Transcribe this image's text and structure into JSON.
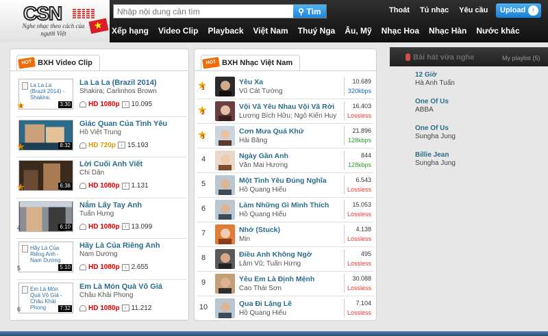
{
  "header": {
    "logo_text": "CSN",
    "slogan": "Nghe nhạc theo cách của người Việt",
    "search_placeholder": "Nhập nội dung cần tìm",
    "search_button": "Tìm",
    "links": [
      "Thoát",
      "Tủ nhạc",
      "Yêu cầu"
    ],
    "upload_label": "Upload"
  },
  "nav": [
    "Xếp hạng",
    "Video Clip",
    "Playback",
    "Việt Nam",
    "Thuý Nga",
    "Âu, Mỹ",
    "Nhạc Hoa",
    "Nhạc Hàn",
    "Nước khác"
  ],
  "video_panel": {
    "title": "BXH Video Clip",
    "hot_badge": "HOT",
    "items": [
      {
        "rank": "1",
        "title": "La La La (Brazil 2014)",
        "artist": "Shakira; Carlinhos Brown",
        "thumb_text": "La La La (Brazil 2014) - Shakira;",
        "duration": "3:30",
        "quality": "HD 1080p",
        "views": "10.095"
      },
      {
        "rank": "2",
        "title": "Giác Quan Của Tình Yêu",
        "artist": "Hồ Việt Trung",
        "thumb_text": "",
        "duration": "8:32",
        "quality": "HD 720p",
        "views": "15.193"
      },
      {
        "rank": "3",
        "title": "Lời Cuối Anh Viết",
        "artist": "Chi Dân",
        "thumb_text": "",
        "duration": "6:38",
        "quality": "HD 1080p",
        "views": "1.131"
      },
      {
        "rank": "4",
        "title": "Nắm Lấy Tay Anh",
        "artist": "Tuấn Hưng",
        "thumb_text": "",
        "duration": "6:10",
        "quality": "HD 1080p",
        "views": "13.099"
      },
      {
        "rank": "5",
        "title": "Hãy Là Của Riêng Anh",
        "artist": "Nam Dương",
        "thumb_text": "Hãy Là Của Riêng Anh - Nam Dương",
        "duration": "5:10",
        "quality": "HD 1080p",
        "views": "2.655"
      },
      {
        "rank": "6",
        "title": "Em Là Món Quà Vô Giá",
        "artist": "Châu Khải Phong",
        "thumb_text": "Em Là Món Quà Vô Giá - Châu Khải Phong",
        "duration": "7:32",
        "quality": "HD 1080p",
        "views": "11.212"
      }
    ]
  },
  "song_panel": {
    "title": "BXH Nhạc Việt Nam",
    "hot_badge": "HOT",
    "items": [
      {
        "rank": "1",
        "title": "Yêu Xa",
        "artist": "Vũ Cát Tường",
        "plays": "10.689",
        "quality": "320kbps"
      },
      {
        "rank": "2",
        "title": "Vội Vã Yêu Nhau Vội Vã Rời",
        "artist": "Lương Bích Hữu; Ngô Kiến Huy",
        "plays": "16.403",
        "quality": "Lossless"
      },
      {
        "rank": "3",
        "title": "Cơn Mưa Quá Khứ",
        "artist": "Hải Băng",
        "plays": "21.896",
        "quality": "128kbps"
      },
      {
        "rank": "4",
        "title": "Ngày Gần Anh",
        "artist": "Văn Mai Hương",
        "plays": "844",
        "quality": "128kbps"
      },
      {
        "rank": "5",
        "title": "Một Tình Yêu Đúng Nghĩa",
        "artist": "Hồ Quang Hiếu",
        "plays": "6.543",
        "quality": "Lossless"
      },
      {
        "rank": "6",
        "title": "Làm Những Gì Mình Thích",
        "artist": "Hồ Quang Hiếu",
        "plays": "15.053",
        "quality": "Lossless"
      },
      {
        "rank": "7",
        "title": "Nhớ (Stuck)",
        "artist": "Min",
        "plays": "4.138",
        "quality": "Lossless"
      },
      {
        "rank": "8",
        "title": "Điều Anh Không Ngờ",
        "artist": "Lâm Vũ; Tuấn Hưng",
        "plays": "495",
        "quality": "Lossless"
      },
      {
        "rank": "9",
        "title": "Yêu Em Là Định Mệnh",
        "artist": "Cao Thái Sơn",
        "plays": "30.088",
        "quality": "Lossless"
      },
      {
        "rank": "10",
        "title": "Qua Đi Lặng Lẽ",
        "artist": "Hồ Quang Hiếu",
        "plays": "7.104",
        "quality": "Lossless"
      }
    ]
  },
  "recent": {
    "title": "Bài hát vừa nghe",
    "playlist_label": "My playlist (5)",
    "items": [
      {
        "title": "12 Giờ",
        "artist": "Hà Anh Tuấn"
      },
      {
        "title": "One Of Us",
        "artist": "ABBA"
      },
      {
        "title": "One Of Us",
        "artist": "Sungha Jung"
      },
      {
        "title": "Billie Jean",
        "artist": "Sungha Jung"
      }
    ]
  },
  "colors": {
    "link_blue": "#2a6d8c",
    "lossless_red": "#e53935",
    "kbps320_blue": "#1565c0",
    "kbps128_green": "#2e9b2e",
    "hd1080_red": "#d40000",
    "hd720_gold": "#d99b00",
    "header_black": "#1a1a1a",
    "upload_blue": "#1f86d8"
  }
}
